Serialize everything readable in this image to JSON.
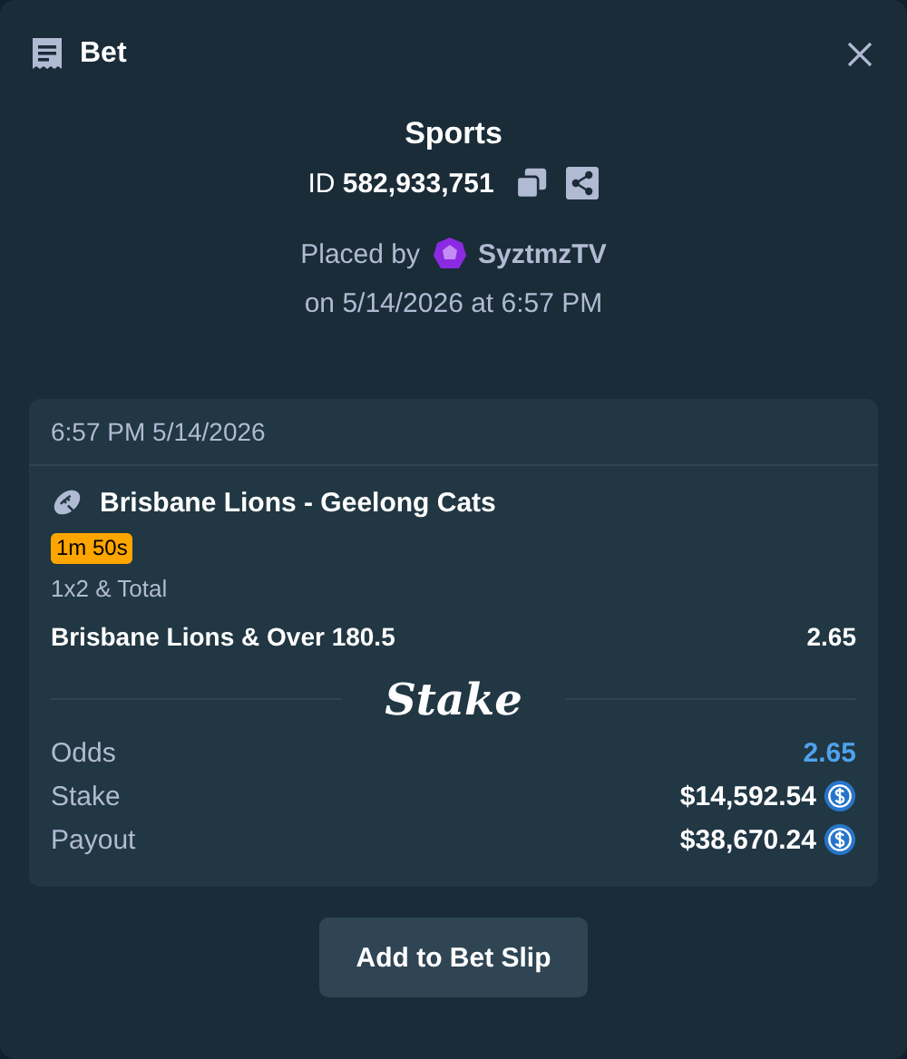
{
  "header": {
    "title": "Bet"
  },
  "summary": {
    "category": "Sports",
    "id_label": "ID",
    "id_value": "582,933,751",
    "placed_by": "Placed by",
    "user": "SyztmzTV",
    "placed_on": "on 5/14/2026 at 6:57 PM"
  },
  "card": {
    "timestamp": "6:57 PM 5/14/2026",
    "match": "Brisbane Lions - Geelong Cats",
    "live_timer": "1m 50s",
    "market": "1x2 & Total",
    "selection": "Brisbane Lions & Over 180.5",
    "selection_odds": "2.65",
    "logo": "Stake",
    "totals": [
      {
        "kind": "odds",
        "label": "Odds",
        "value": "2.65"
      },
      {
        "kind": "amount",
        "label": "Stake",
        "value": "$14,592.54"
      },
      {
        "kind": "amount",
        "label": "Payout",
        "value": "$38,670.24"
      }
    ]
  },
  "action": "Add to Bet Slip"
}
